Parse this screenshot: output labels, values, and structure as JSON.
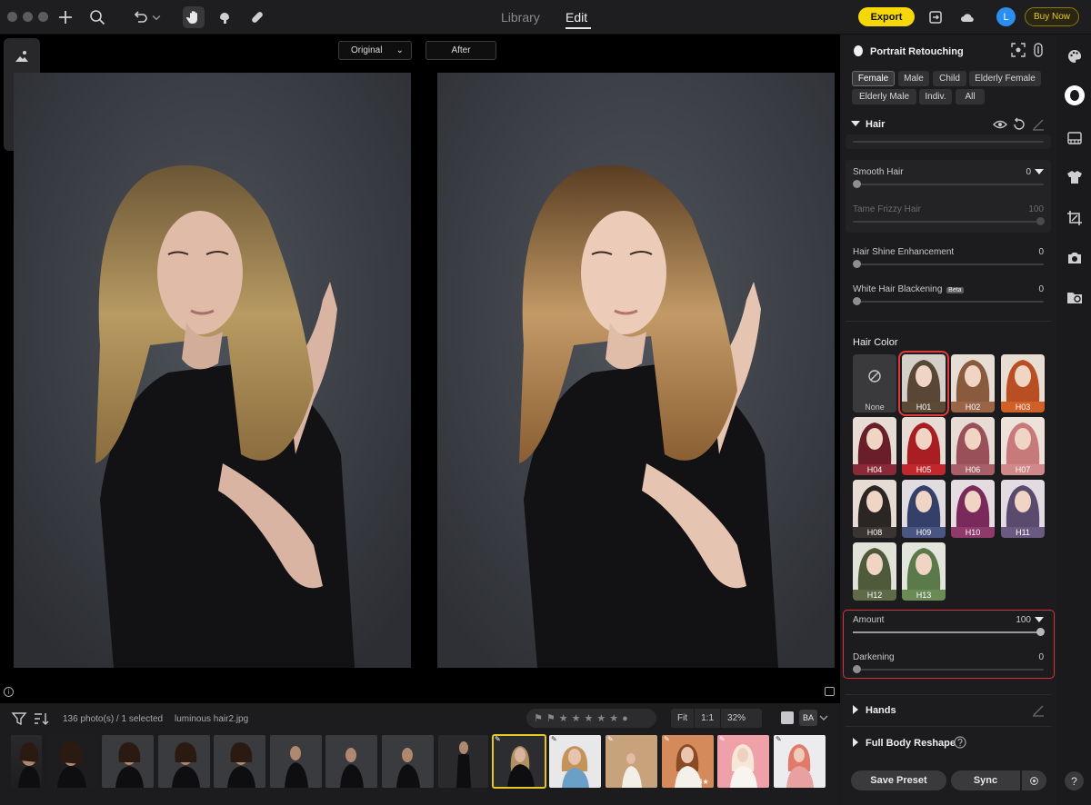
{
  "titlebar": {
    "tabs": [
      "Library",
      "Edit"
    ],
    "active_tab": "Edit",
    "export_label": "Export",
    "avatar_initial": "L",
    "buy_now_label": "Buy Now",
    "accent_color": "#f6d80a"
  },
  "canvas": {
    "view_mode": "Original",
    "after_label": "After"
  },
  "filmstrip": {
    "photo_count": "136 photo(s) / 1 selected",
    "file_name": "luminous hair2.jpg",
    "zoom_fit": "Fit",
    "zoom_one": "1:1",
    "zoom_level": "32%",
    "thumb_star_badge": "3★"
  },
  "panel": {
    "title": "Portrait Retouching",
    "filters": [
      "Female",
      "Male",
      "Child",
      "Elderly Female",
      "Elderly Male",
      "Indiv.",
      "All"
    ],
    "active_filter": "Female",
    "hair_section": "Hair",
    "sliders": [
      {
        "label": "Smooth Hair",
        "value": "0"
      },
      {
        "label": "Tame Frizzy Hair",
        "value": "100"
      },
      {
        "label": "Hair Shine Enhancement",
        "value": "0"
      },
      {
        "label": "White Hair Blackening",
        "value": "0",
        "badge": "Beta"
      }
    ],
    "hair_color_title": "Hair Color",
    "swatch_none": "None",
    "swatches": [
      "H01",
      "H02",
      "H03",
      "H04",
      "H05",
      "H06",
      "H07",
      "H08",
      "H09",
      "H10",
      "H11",
      "H12",
      "H13"
    ],
    "selected_swatch": "H01",
    "amount": {
      "label": "Amount",
      "value": "100"
    },
    "darkening": {
      "label": "Darkening",
      "value": "0"
    },
    "hands_section": "Hands",
    "body_section": "Full Body Reshape",
    "save_preset": "Save Preset",
    "sync": "Sync",
    "highlight_color": "#d8333d"
  }
}
